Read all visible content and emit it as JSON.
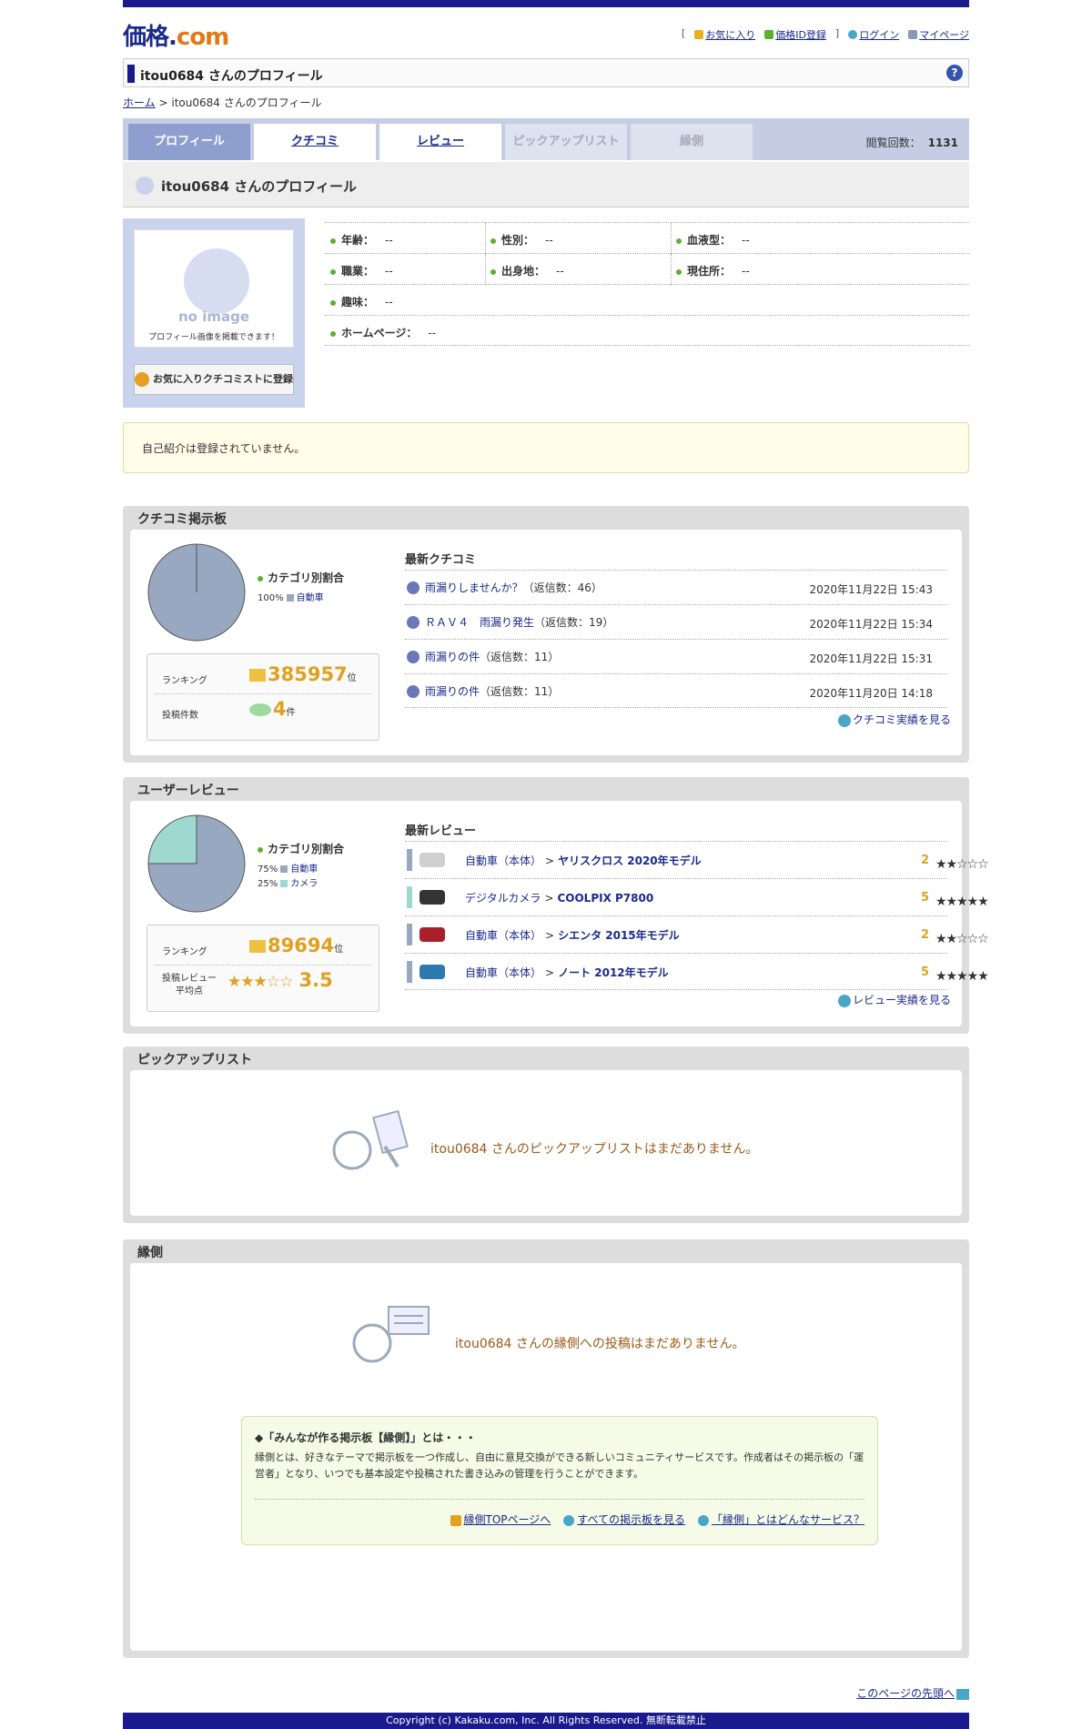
{
  "header": {
    "logo_main": "価格",
    "logo_dot": ".",
    "logo_com": "com",
    "links": [
      {
        "label": "お気に入り",
        "icon": "bookmark-icon"
      },
      {
        "label": "価格ID登録",
        "icon": "id-icon"
      },
      {
        "label": "ログイン",
        "icon": "login-icon"
      },
      {
        "label": "マイページ",
        "icon": "list-icon"
      }
    ],
    "bracket_open": "[",
    "bracket_close": "]"
  },
  "title": "itou0684 さんのプロフィール",
  "help_icon": "?",
  "breadcrumb": {
    "home": "ホーム",
    "sep": ">",
    "current": "itou0684 さんのプロフィール"
  },
  "tabs": [
    {
      "label": "プロフィール",
      "state": "active"
    },
    {
      "label": "クチコミ",
      "state": "link"
    },
    {
      "label": "レビュー",
      "state": "link"
    },
    {
      "label": "ピックアップリスト",
      "state": "disabled"
    },
    {
      "label": "縁側",
      "state": "disabled"
    }
  ],
  "views": {
    "label": "閲覧回数：",
    "value": "1131"
  },
  "profile_heading": "itou0684 さんのプロフィール",
  "avatar": {
    "no_image": "no image",
    "note": "プロフィール画像を掲載できます！"
  },
  "fav_button": "お気に入りクチコミストに登録",
  "info": {
    "age": {
      "label": "年齢：",
      "value": "--"
    },
    "gender": {
      "label": "性別：",
      "value": "--"
    },
    "blood": {
      "label": "血液型：",
      "value": "--"
    },
    "job": {
      "label": "職業：",
      "value": "--"
    },
    "birthplace": {
      "label": "出身地：",
      "value": "--"
    },
    "residence": {
      "label": "現住所：",
      "value": "--"
    },
    "hobby": {
      "label": "趣味：",
      "value": "--"
    },
    "homepage": {
      "label": "ホームページ：",
      "value": "--"
    }
  },
  "intro": "自己紹介は登録されていません。",
  "kuchikomi": {
    "title": "クチコミ掲示板",
    "category_label": "カテゴリ別割合",
    "categories": [
      {
        "pct": "100%",
        "name": "自動車",
        "share": 1.0,
        "color": "#98a8c0"
      }
    ],
    "ranking_label": "ランキング",
    "ranking_value": "385957",
    "ranking_unit": "位",
    "posts_label": "投稿件数",
    "posts_value": "4",
    "posts_unit": "件",
    "latest_label": "最新クチコミ",
    "items": [
      {
        "title": "雨漏りしませんか？",
        "replies": "（返信数：46）",
        "date": "2020年11月22日 15:43"
      },
      {
        "title": "ＲＡＶ４　雨漏り発生",
        "replies": "（返信数：19）",
        "date": "2020年11月22日 15:34"
      },
      {
        "title": "雨漏りの件",
        "replies": "（返信数：11）",
        "date": "2020年11月22日 15:31"
      },
      {
        "title": "雨漏りの件",
        "replies": "（返信数：11）",
        "date": "2020年11月20日 14:18"
      }
    ],
    "more": "クチコミ実績を見る"
  },
  "review": {
    "title": "ユーザーレビュー",
    "category_label": "カテゴリ別割合",
    "categories": [
      {
        "pct": "75%",
        "name": "自動車",
        "share": 0.75,
        "color": "#98a8c0"
      },
      {
        "pct": "25%",
        "name": "カメラ",
        "share": 0.25,
        "color": "#9fd8d0"
      }
    ],
    "ranking_label": "ランキング",
    "ranking_value": "89694",
    "ranking_unit": "位",
    "avg_label_1": "投稿レビュー",
    "avg_label_2": "平均点",
    "avg_value": "3.5",
    "avg_stars": "★★★☆☆",
    "latest_label": "最新レビュー",
    "items": [
      {
        "category": "自動車（本体）",
        "gt": ">",
        "product": "ヤリスクロス 2020年モデル",
        "stars": "★★☆☆☆",
        "score": "2",
        "bar": "#98a8c0",
        "thumb": "#cfcfcf"
      },
      {
        "category": "デジタルカメラ",
        "gt": ">",
        "product": "COOLPIX P7800",
        "stars": "★★★★★",
        "score": "5",
        "bar": "#9fd8d0",
        "thumb": "#333333"
      },
      {
        "category": "自動車（本体）",
        "gt": ">",
        "product": "シエンタ 2015年モデル",
        "stars": "★★☆☆☆",
        "score": "2",
        "bar": "#98a8c0",
        "thumb": "#a8202a"
      },
      {
        "category": "自動車（本体）",
        "gt": ">",
        "product": "ノート 2012年モデル",
        "stars": "★★★★★",
        "score": "5",
        "bar": "#98a8c0",
        "thumb": "#2a7ab0"
      }
    ],
    "more": "レビュー実績を見る"
  },
  "pickup": {
    "title": "ピックアップリスト",
    "empty": "itou0684 さんのピックアップリストはまだありません。"
  },
  "engawa": {
    "title": "縁側",
    "empty": "itou0684 さんの縁側への投稿はまだありません。",
    "info_head": "◆「みんなが作る掲示板【縁側】」とは・・・",
    "info_body": "縁側とは、好きなテーマで掲示板を一つ作成し、自由に意見交換ができる新しいコミュニティサービスです。作成者はその掲示板の「運営者」となり、いつでも基本設定や投稿された書き込みの管理を行うことができます。",
    "links": [
      "縁側TOPページへ",
      "すべての掲示板を見る",
      "「縁側」とはどんなサービス？"
    ]
  },
  "totop": "このページの先頭へ",
  "footer": "Copyright (c) Kakaku.com, Inc. All Rights Reserved. 無断転載禁止"
}
